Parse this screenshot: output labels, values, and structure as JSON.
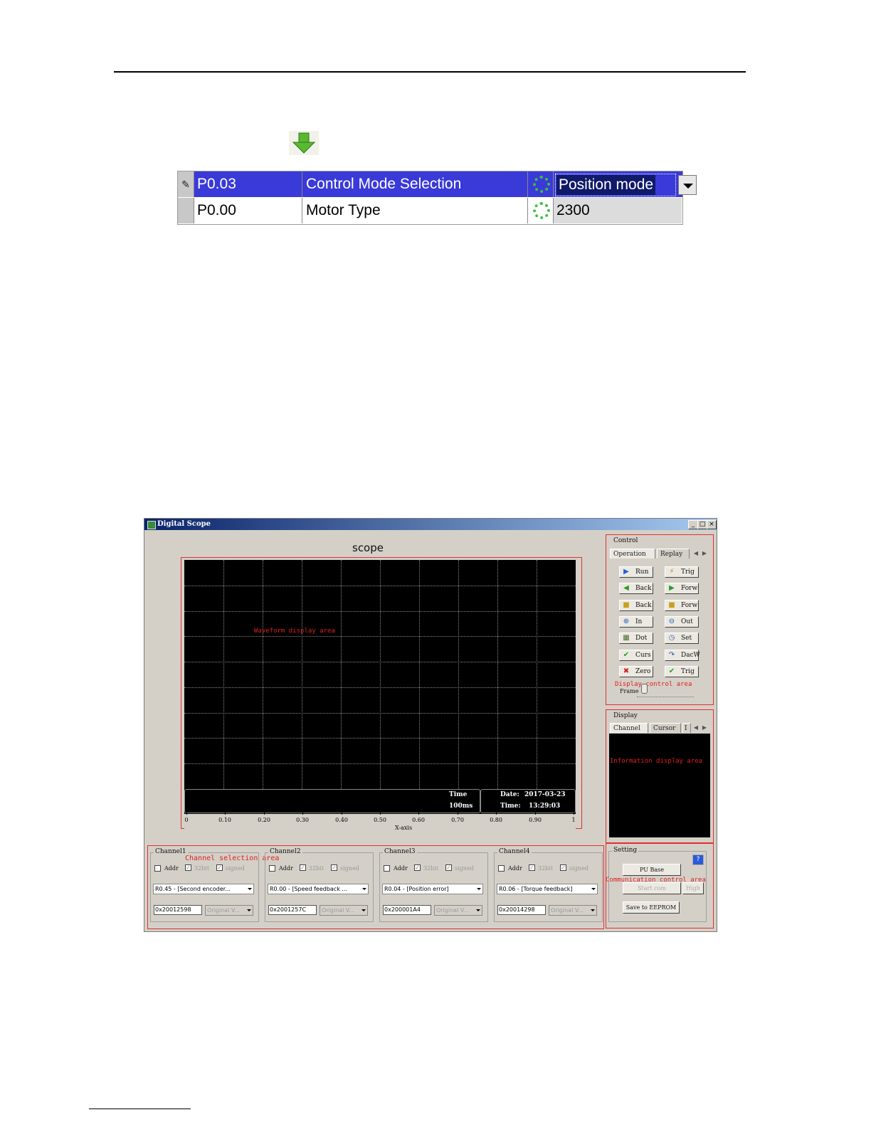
{
  "param_table": {
    "rows": [
      {
        "code": "P0.03",
        "name": "Control Mode Selection",
        "value": "Position mode",
        "selected": true
      },
      {
        "code": "P0.00",
        "name": "Motor Type",
        "value": "2300",
        "selected": false
      }
    ]
  },
  "scope_window": {
    "title": "Digital Scope",
    "scope_title": "scope",
    "waveform_area_label": "Waveform display area",
    "time_label": "Time",
    "time_value": "100ms",
    "date_label": "Date:",
    "date_value": "2017-03-23",
    "clock_label": "Time:",
    "clock_value": "13:29:03",
    "x_ticks": [
      "0",
      "0.10",
      "0.20",
      "0.30",
      "0.40",
      "0.50",
      "0.60",
      "0.70",
      "0.80",
      "0.90",
      "1"
    ],
    "x_axis_label": "X-axis",
    "control": {
      "title": "Control",
      "tabs": [
        "Operation",
        "Replay"
      ],
      "buttons": [
        {
          "label": "Run",
          "icon": "play-icon",
          "color": "#1f5fd0"
        },
        {
          "label": "Trig",
          "icon": "lightning-icon",
          "color": "#e07a10"
        },
        {
          "label": "Back",
          "icon": "back-circle-icon",
          "color": "#2a9a2a"
        },
        {
          "label": "Forw",
          "icon": "forward-circle-icon",
          "color": "#2a9a2a"
        },
        {
          "label": "Back",
          "icon": "back-frame-icon",
          "color": "#c8a020"
        },
        {
          "label": "Forw",
          "icon": "forward-frame-icon",
          "color": "#c8a020"
        },
        {
          "label": "In",
          "icon": "zoom-in-icon",
          "color": "#2060c0"
        },
        {
          "label": "Out",
          "icon": "zoom-out-icon",
          "color": "#2060c0"
        },
        {
          "label": "Dot",
          "icon": "dot-grid-icon",
          "color": "#4a6a2a"
        },
        {
          "label": "Set",
          "icon": "clock-icon",
          "color": "#4060a0"
        },
        {
          "label": "Curs",
          "icon": "check-icon",
          "color": "#20a020"
        },
        {
          "label": "DacW",
          "icon": "redo-icon",
          "color": "#2050c0"
        },
        {
          "label": "Zero",
          "icon": "x-icon",
          "color": "#d02020"
        },
        {
          "label": "Trig",
          "icon": "check-icon",
          "color": "#20a020"
        }
      ],
      "area_label": "Display control area",
      "frame_label": "Frame"
    },
    "display": {
      "title": "Display",
      "tabs": [
        "Channel",
        "Cursor",
        "I"
      ],
      "area_label": "Information display area"
    },
    "channels": [
      {
        "title": "Channel1",
        "addr_label": "Addr",
        "bit_label": "32bit",
        "signed_label": "signed",
        "param": "R0.45 - [Second encoder...",
        "address": "0x20012598",
        "format": "Original V..."
      },
      {
        "title": "Channel2",
        "addr_label": "Addr",
        "bit_label": "32bit",
        "signed_label": "signed",
        "param": "R0.00 - [Speed feedback ...",
        "address": "0x2001257C",
        "format": "Original V..."
      },
      {
        "title": "Channel3",
        "addr_label": "Addr",
        "bit_label": "32bit",
        "signed_label": "signed",
        "param": "R0.04 - [Position error]",
        "address": "0x200001A4",
        "format": "Original V..."
      },
      {
        "title": "Channel4",
        "addr_label": "Addr",
        "bit_label": "32bit",
        "signed_label": "signed",
        "param": "R0.06 - [Torque feedback]",
        "address": "0x20014298",
        "format": "Original V..."
      }
    ],
    "channel_area_label": "Channel selection area",
    "setting": {
      "title": "Setting",
      "pu_base": "PU Base",
      "start_com": "Start com",
      "high": "High",
      "save_eeprom": "Save to EEPROM",
      "area_label": "Communication control area"
    }
  }
}
